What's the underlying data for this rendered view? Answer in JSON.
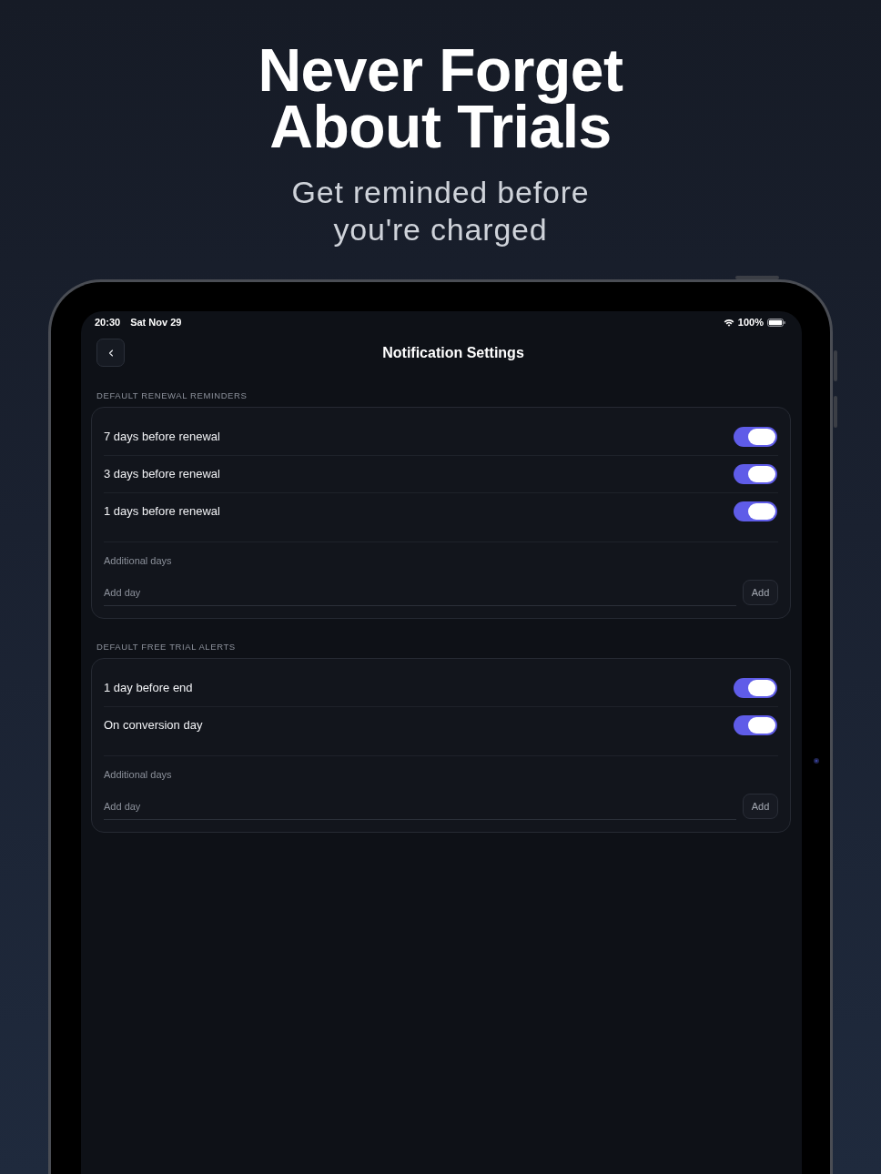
{
  "headline": {
    "title": "Never Forget About Trials",
    "subtitle": "Get reminded before you're charged"
  },
  "status_bar": {
    "time": "20:30",
    "date": "Sat Nov 29",
    "battery": "100%"
  },
  "nav": {
    "title": "Notification Settings"
  },
  "sections": [
    {
      "header": "DEFAULT RENEWAL REMINDERS",
      "toggles": [
        {
          "label": "7 days before renewal",
          "on": true
        },
        {
          "label": "3 days before renewal",
          "on": true
        },
        {
          "label": "1 days before renewal",
          "on": true
        }
      ],
      "additional": {
        "label": "Additional days",
        "placeholder": "Add day",
        "button": "Add"
      }
    },
    {
      "header": "DEFAULT FREE TRIAL ALERTS",
      "toggles": [
        {
          "label": "1 day before end",
          "on": true
        },
        {
          "label": "On conversion day",
          "on": true
        }
      ],
      "additional": {
        "label": "Additional days",
        "placeholder": "Add day",
        "button": "Add"
      }
    }
  ]
}
